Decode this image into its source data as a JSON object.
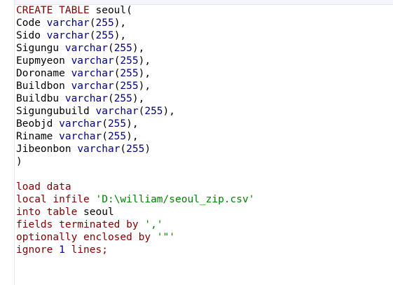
{
  "editor": {
    "colors": {
      "keyword": "#7f0000",
      "type": "#000080",
      "number": "#000080",
      "string": "#008000",
      "plain": "#000000"
    },
    "lines": [
      [
        {
          "t": "kw",
          "s": "CREATE TABLE"
        },
        {
          "t": "plain",
          "s": " seoul("
        }
      ],
      [
        {
          "t": "plain",
          "s": "Code "
        },
        {
          "t": "type",
          "s": "varchar"
        },
        {
          "t": "plain",
          "s": "("
        },
        {
          "t": "num",
          "s": "255"
        },
        {
          "t": "plain",
          "s": "),"
        }
      ],
      [
        {
          "t": "plain",
          "s": "Sido "
        },
        {
          "t": "type",
          "s": "varchar"
        },
        {
          "t": "plain",
          "s": "("
        },
        {
          "t": "num",
          "s": "255"
        },
        {
          "t": "plain",
          "s": "),"
        }
      ],
      [
        {
          "t": "plain",
          "s": "Sigungu "
        },
        {
          "t": "type",
          "s": "varchar"
        },
        {
          "t": "plain",
          "s": "("
        },
        {
          "t": "num",
          "s": "255"
        },
        {
          "t": "plain",
          "s": "),"
        }
      ],
      [
        {
          "t": "plain",
          "s": "Eupmyeon "
        },
        {
          "t": "type",
          "s": "varchar"
        },
        {
          "t": "plain",
          "s": "("
        },
        {
          "t": "num",
          "s": "255"
        },
        {
          "t": "plain",
          "s": "),"
        }
      ],
      [
        {
          "t": "plain",
          "s": "Doroname "
        },
        {
          "t": "type",
          "s": "varchar"
        },
        {
          "t": "plain",
          "s": "("
        },
        {
          "t": "num",
          "s": "255"
        },
        {
          "t": "plain",
          "s": "),"
        }
      ],
      [
        {
          "t": "plain",
          "s": "Buildbon "
        },
        {
          "t": "type",
          "s": "varchar"
        },
        {
          "t": "plain",
          "s": "("
        },
        {
          "t": "num",
          "s": "255"
        },
        {
          "t": "plain",
          "s": "),"
        }
      ],
      [
        {
          "t": "plain",
          "s": "Buildbu "
        },
        {
          "t": "type",
          "s": "varchar"
        },
        {
          "t": "plain",
          "s": "("
        },
        {
          "t": "num",
          "s": "255"
        },
        {
          "t": "plain",
          "s": "),"
        }
      ],
      [
        {
          "t": "plain",
          "s": "Sigungubuild "
        },
        {
          "t": "type",
          "s": "varchar"
        },
        {
          "t": "plain",
          "s": "("
        },
        {
          "t": "num",
          "s": "255"
        },
        {
          "t": "plain",
          "s": "),"
        }
      ],
      [
        {
          "t": "plain",
          "s": "Beobjd "
        },
        {
          "t": "type",
          "s": "varchar"
        },
        {
          "t": "plain",
          "s": "("
        },
        {
          "t": "num",
          "s": "255"
        },
        {
          "t": "plain",
          "s": "),"
        }
      ],
      [
        {
          "t": "plain",
          "s": "Riname "
        },
        {
          "t": "type",
          "s": "varchar"
        },
        {
          "t": "plain",
          "s": "("
        },
        {
          "t": "num",
          "s": "255"
        },
        {
          "t": "plain",
          "s": "),"
        }
      ],
      [
        {
          "t": "plain",
          "s": "Jibeonbon "
        },
        {
          "t": "type",
          "s": "varchar"
        },
        {
          "t": "plain",
          "s": "("
        },
        {
          "t": "num",
          "s": "255"
        },
        {
          "t": "plain",
          "s": ")"
        }
      ],
      [
        {
          "t": "plain",
          "s": ")"
        }
      ],
      [],
      [
        {
          "t": "kw",
          "s": "load data"
        }
      ],
      [
        {
          "t": "kw",
          "s": "local infile"
        },
        {
          "t": "plain",
          "s": " "
        },
        {
          "t": "str",
          "s": "'D:\\william/seoul_zip.csv'"
        }
      ],
      [
        {
          "t": "kw",
          "s": "into table"
        },
        {
          "t": "plain",
          "s": " seoul"
        }
      ],
      [
        {
          "t": "kw",
          "s": "fields terminated by"
        },
        {
          "t": "plain",
          "s": " "
        },
        {
          "t": "str",
          "s": "','"
        }
      ],
      [
        {
          "t": "kw",
          "s": "optionally enclosed by"
        },
        {
          "t": "plain",
          "s": " "
        },
        {
          "t": "str",
          "s": "'\"'"
        }
      ],
      [
        {
          "t": "kw",
          "s": "ignore"
        },
        {
          "t": "plain",
          "s": " "
        },
        {
          "t": "num",
          "s": "1"
        },
        {
          "t": "plain",
          "s": " "
        },
        {
          "t": "kw",
          "s": "lines;"
        }
      ]
    ]
  }
}
